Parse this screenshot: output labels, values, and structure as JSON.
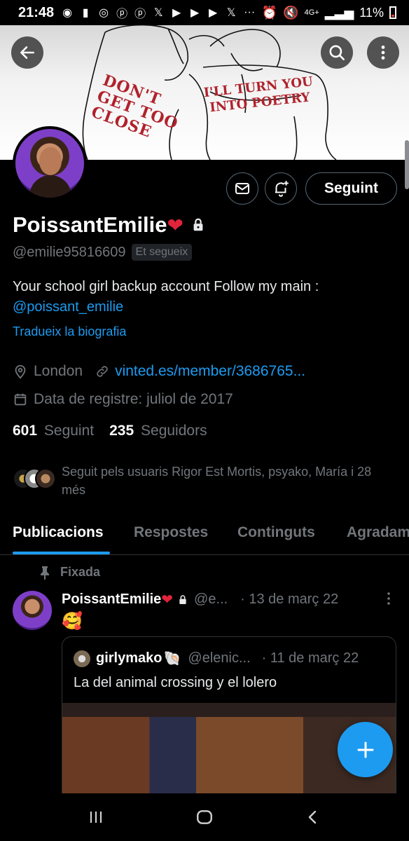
{
  "status_bar": {
    "time": "21:48",
    "network": "4G+",
    "battery": "11%"
  },
  "profile": {
    "display_name": "PoissantEmilie",
    "handle": "@emilie95816609",
    "follows_you_badge": "Et segueix",
    "follow_button": "Seguint",
    "bio_text": "Your school girl backup account  Follow my main :",
    "bio_mention": "@poissant_emilie",
    "translate_bio": "Tradueix la biografia",
    "location": "London",
    "website": "vinted.es/member/3686765...",
    "joined": "Data de registre: juliol de 2017",
    "following_count": "601",
    "following_label": "Seguint",
    "followers_count": "235",
    "followers_label": "Seguidors",
    "followed_by_text": "Seguit pels usuaris Rigor Est Mortis, psyako, María i 28 més"
  },
  "banner": {
    "text_left": "DON'T GET TOO CLOSE",
    "text_right": "I'LL TURN YOU INTO POETRY"
  },
  "tabs": [
    "Publicacions",
    "Respostes",
    "Continguts",
    "Agradam"
  ],
  "pinned_label": "Fixada",
  "tweet": {
    "name": "PoissantEmilie",
    "handle": "@e...",
    "date": "· 13 de març 22",
    "text": "🥰",
    "quote": {
      "name": "girlymako",
      "handle": "@elenic...",
      "date": "· 11 de març 22",
      "text": "La del animal crossing y el lolero"
    }
  },
  "colors": {
    "accent": "#1d9bf0",
    "background": "#000000",
    "muted": "#71767b",
    "heart": "#e0243b"
  }
}
